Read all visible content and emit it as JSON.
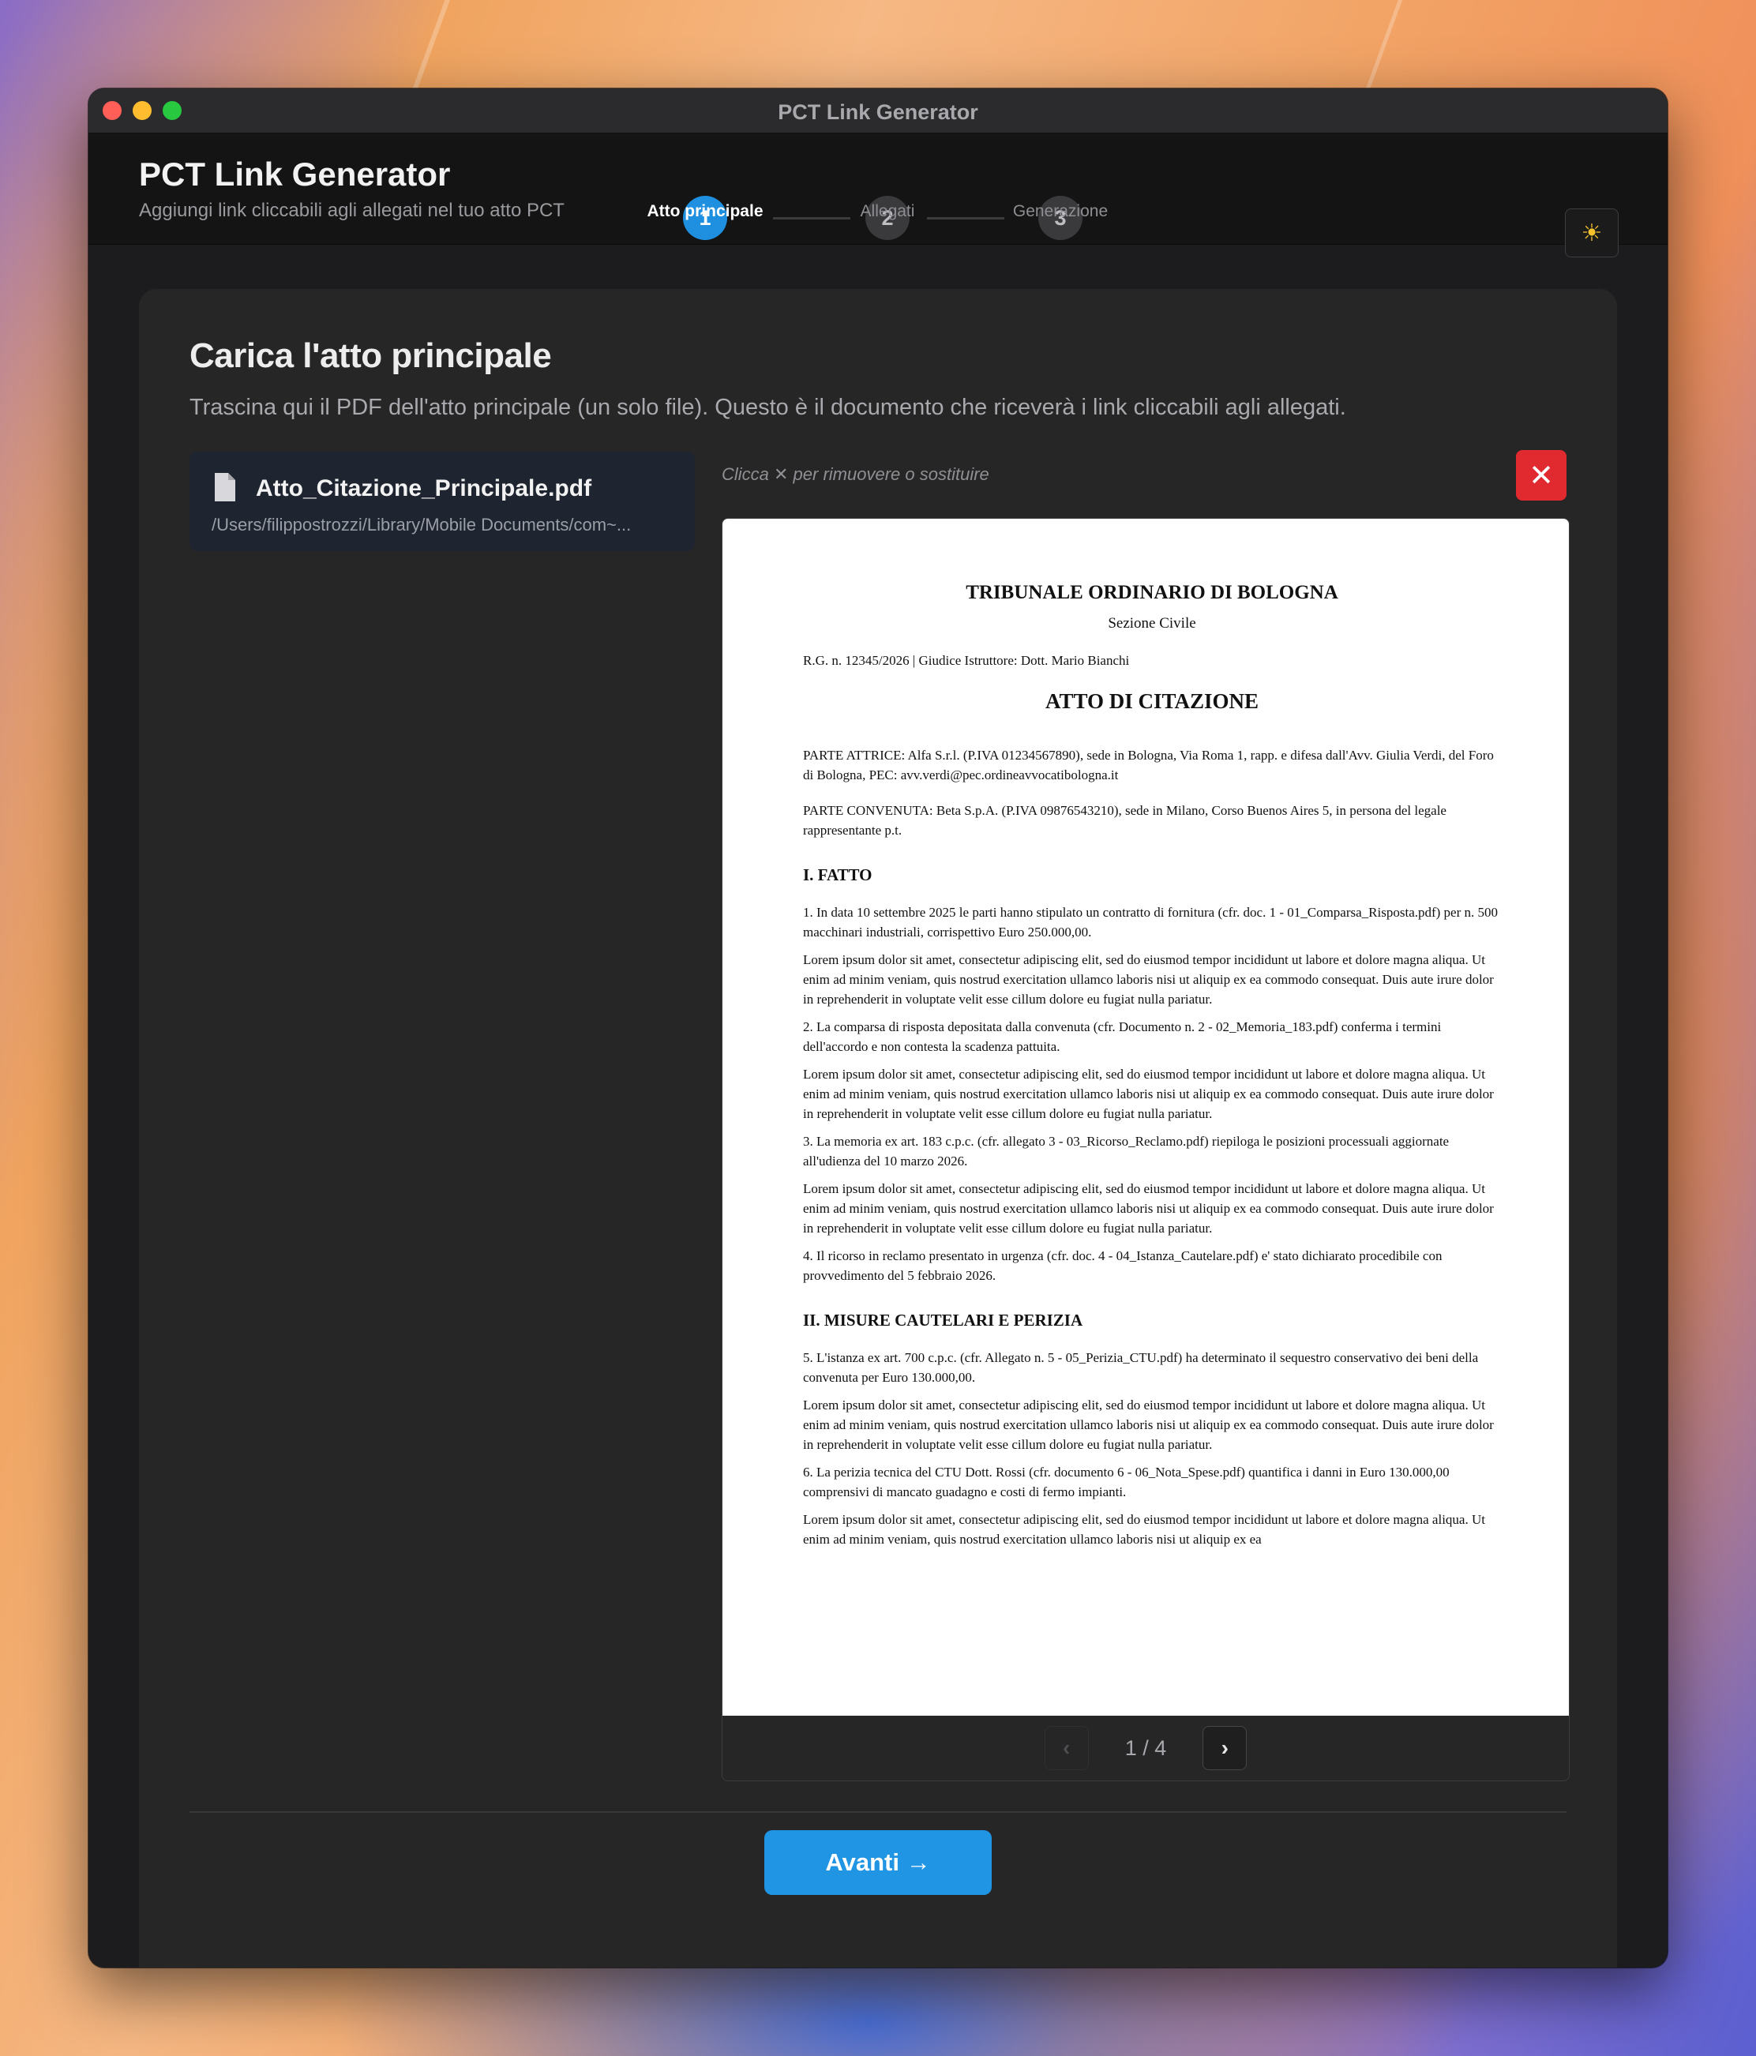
{
  "window": {
    "title": "PCT Link Generator"
  },
  "header": {
    "title": "PCT Link Generator",
    "subtitle": "Aggiungi link cliccabili agli allegati nel tuo atto PCT",
    "steps": [
      {
        "number": "1",
        "label": "Atto principale",
        "active": true
      },
      {
        "number": "2",
        "label": "Allegati",
        "active": false
      },
      {
        "number": "3",
        "label": "Generazione",
        "active": false
      }
    ],
    "theme_icon": "sun-icon"
  },
  "main": {
    "title": "Carica l'atto principale",
    "description": "Trascina qui il PDF dell'atto principale (un solo file). Questo è il documento che riceverà i link cliccabili agli allegati.",
    "file": {
      "name": "Atto_Citazione_Principale.pdf",
      "path": "/Users/filippostrozzi/Library/Mobile Documents/com~..."
    },
    "hint": "Clicca ✕ per rimuovere o sostituire",
    "remove_icon": "close-icon",
    "document": {
      "court": "TRIBUNALE ORDINARIO DI BOLOGNA",
      "section": "Sezione Civile",
      "rg": "R.G. n. 12345/2026 | Giudice Istruttore: Dott. Mario Bianchi",
      "heading": "ATTO DI CITAZIONE",
      "party_attrice": "PARTE ATTRICE: Alfa S.r.l. (P.IVA 01234567890), sede in Bologna, Via Roma 1, rapp. e difesa dall'Avv. Giulia Verdi, del Foro di Bologna, PEC: avv.verdi@pec.ordineavvocatibologna.it",
      "party_convenuta": "PARTE CONVENUTA: Beta S.p.A. (P.IVA 09876543210), sede in Milano, Corso Buenos Aires 5, in persona del legale rappresentante p.t.",
      "section1": "I. FATTO",
      "p1": "1. In data 10 settembre 2025 le parti hanno stipulato un contratto di fornitura (cfr. doc. 1 - 01_Comparsa_Risposta.pdf) per n. 500 macchinari industriali, corrispettivo Euro 250.000,00.",
      "lorem": "Lorem ipsum dolor sit amet, consectetur adipiscing elit, sed do eiusmod tempor incididunt ut labore et dolore magna aliqua. Ut enim ad minim veniam, quis nostrud exercitation ullamco laboris nisi ut aliquip ex ea commodo consequat. Duis aute irure dolor in reprehenderit in voluptate velit esse cillum dolore eu fugiat nulla pariatur.",
      "p2": "2. La comparsa di risposta depositata dalla convenuta (cfr. Documento n. 2 - 02_Memoria_183.pdf) conferma i termini dell'accordo e non contesta la scadenza pattuita.",
      "p3": "3. La memoria ex art. 183 c.p.c. (cfr. allegato 3 - 03_Ricorso_Reclamo.pdf) riepiloga le posizioni processuali aggiornate all'udienza del 10 marzo 2026.",
      "p4": "4. Il ricorso in reclamo presentato in urgenza (cfr. doc. 4 - 04_Istanza_Cautelare.pdf) e' stato dichiarato procedibile con provvedimento del 5 febbraio 2026.",
      "section2": "II. MISURE CAUTELARI E PERIZIA",
      "p5": "5. L'istanza ex art. 700 c.p.c. (cfr. Allegato n. 5 - 05_Perizia_CTU.pdf) ha determinato il sequestro conservativo dei beni della convenuta per Euro 130.000,00.",
      "p6": "6. La perizia tecnica del CTU Dott. Rossi (cfr. documento 6 - 06_Nota_Spese.pdf) quantifica i danni in Euro 130.000,00 comprensivi di mancato guadagno e costi di fermo impianti.",
      "lorem_cut": "Lorem ipsum dolor sit amet, consectetur adipiscing elit, sed do eiusmod tempor incididunt ut labore et dolore magna aliqua. Ut enim ad minim veniam, quis nostrud exercitation ullamco laboris nisi ut aliquip ex ea"
    },
    "pager": {
      "prev": "‹",
      "label": "1 / 4",
      "next": "›"
    },
    "next_button": "Avanti →"
  }
}
